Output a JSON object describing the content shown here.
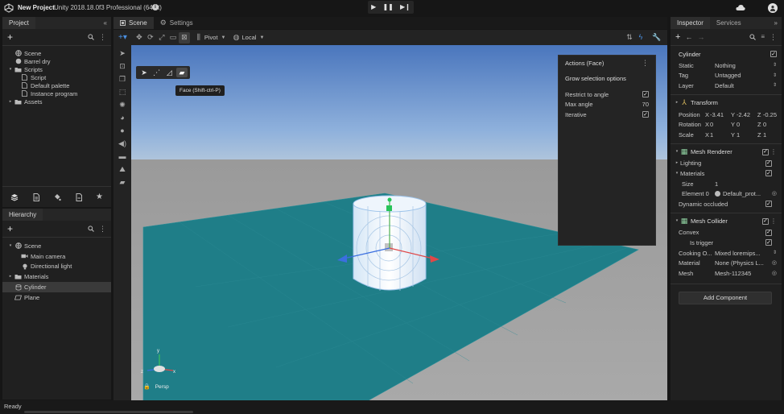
{
  "titlebar": {
    "project": "New Project",
    "version": "Unity 2018.18.0f3 Professional (64bit)"
  },
  "project_panel": {
    "tab": "Project",
    "items": [
      {
        "label": "Scene",
        "icon": "scene-icon",
        "indent": 0
      },
      {
        "label": "Barrel dry",
        "icon": "sphere-icon",
        "indent": 0
      },
      {
        "label": "Scripts",
        "icon": "folder-icon",
        "indent": 0,
        "expanded": true
      },
      {
        "label": "Script",
        "icon": "file-icon",
        "indent": 1
      },
      {
        "label": "Default palette",
        "icon": "file-icon",
        "indent": 1
      },
      {
        "label": "Instance program",
        "icon": "file-icon",
        "indent": 1
      },
      {
        "label": "Assets",
        "icon": "folder-icon",
        "indent": 0,
        "expanded": false
      }
    ]
  },
  "hierarchy_panel": {
    "tab": "Hierarchy",
    "items": [
      {
        "label": "Scene",
        "icon": "scene-icon",
        "indent": 0,
        "expanded": true
      },
      {
        "label": "Main camera",
        "icon": "camera-icon",
        "indent": 1
      },
      {
        "label": "Directional light",
        "icon": "light-icon",
        "indent": 1
      },
      {
        "label": "Materials",
        "icon": "folder-icon",
        "indent": 0,
        "expanded": false
      },
      {
        "label": "Cylinder",
        "icon": "cylinder-icon",
        "indent": 0,
        "selected": true
      },
      {
        "label": "Plane",
        "icon": "plane-icon",
        "indent": 0
      }
    ]
  },
  "scene_view": {
    "tabs": [
      "Scene",
      "Settings"
    ],
    "pivot_label": "Pivot",
    "space_label": "Local",
    "tooltip": "Face (Shift-ctrl-P)",
    "persp_label": "Persp",
    "actions_panel": {
      "title": "Actions (Face)",
      "heading": "Grow selection options",
      "rows": [
        {
          "label": "Restrict to angle",
          "type": "checkbox",
          "checked": true
        },
        {
          "label": "Max angle",
          "type": "value",
          "value": "70"
        },
        {
          "label": "Iterative",
          "type": "checkbox",
          "checked": true
        }
      ]
    }
  },
  "inspector": {
    "tabs": [
      "Inspector",
      "Services"
    ],
    "object_name": "Cylinder",
    "static_label": "Static",
    "static_value": "Nothing",
    "tag_label": "Tag",
    "tag_value": "Untagged",
    "layer_label": "Layer",
    "layer_value": "Default",
    "transform": {
      "title": "Transform",
      "position_label": "Position",
      "rotation_label": "Rotation",
      "scale_label": "Scale",
      "position": [
        "-3.41",
        "-2.42",
        "-0.25"
      ],
      "rotation": [
        "0",
        "0",
        "0"
      ],
      "scale": [
        "1",
        "1",
        "1"
      ]
    },
    "mesh_renderer": {
      "title": "Mesh Renderer",
      "lighting_label": "Lighting",
      "materials_label": "Materials",
      "size_label": "Size",
      "size_value": "1",
      "element_label": "Element 0",
      "element_value": "Default_prot...",
      "dynamic_label": "Dynamic occluded"
    },
    "mesh_collider": {
      "title": "Mesh Collider",
      "convex_label": "Convex",
      "trigger_label": "Is trigger",
      "cooking_label": "Cooking O...",
      "cooking_value": "Mixed loremips...",
      "material_label": "Material",
      "material_value": "None (Physics L...",
      "mesh_label": "Mesh",
      "mesh_value": "Mesh-112345"
    },
    "add_component": "Add Component"
  },
  "status": {
    "text": "Ready"
  },
  "colors": {
    "accent": "#4a90e2",
    "sky_top": "#4d78bf",
    "ground": "#1e7e88",
    "panel": "#202020"
  }
}
